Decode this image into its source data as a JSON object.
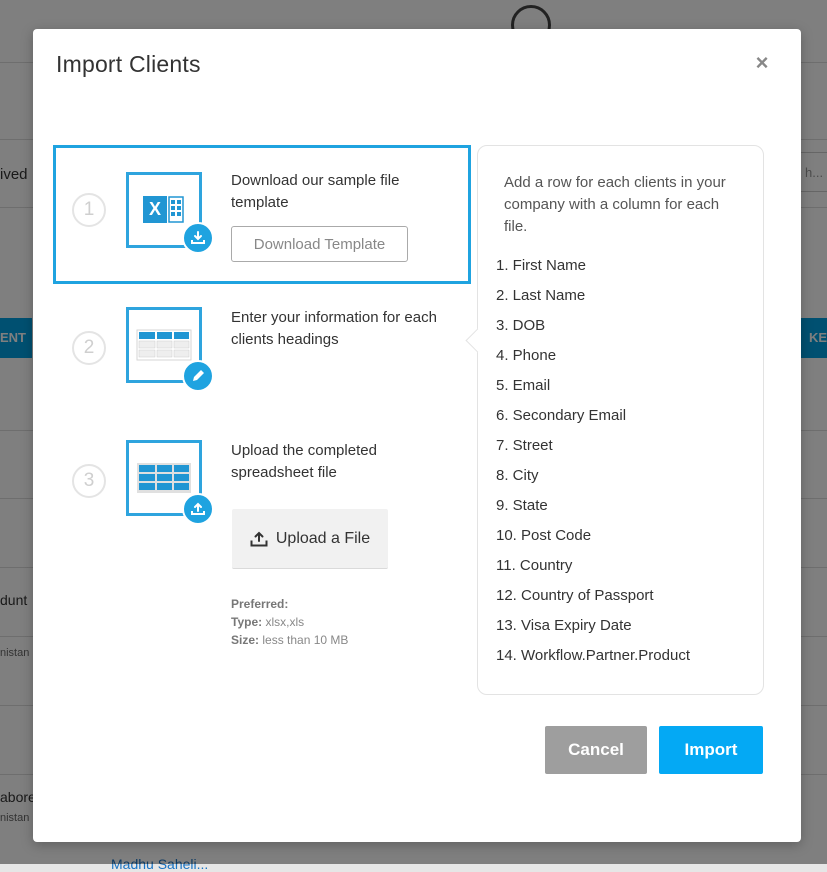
{
  "background": {
    "left_texts": [
      "ived",
      "dunt",
      "nistan",
      "abore",
      "nistan"
    ],
    "header_left": "ENT",
    "header_right": "KE",
    "search_placeholder": "h...",
    "bottom_link": "Madhu Saheli..."
  },
  "modal": {
    "title": "Import Clients",
    "close_symbol": "×",
    "steps": [
      {
        "number": "1",
        "text": "Download our sample file template",
        "button_label": "Download Template",
        "icon": "excel-file-icon",
        "badge_icon": "download-icon"
      },
      {
        "number": "2",
        "text": "Enter your information for each clients headings",
        "icon": "spreadsheet-icon",
        "badge_icon": "pencil-icon"
      },
      {
        "number": "3",
        "text": "Upload the completed spreadsheet file",
        "icon": "spreadsheet-icon",
        "badge_icon": "upload-icon",
        "button_label": "Upload a File",
        "preferred_label": "Preferred:",
        "type_label": "Type:",
        "type_value": "xlsx,xls",
        "size_label": "Size:",
        "size_value": "less than 10 MB"
      }
    ],
    "info": {
      "intro": "Add a row for each clients in your company with a column for each file.",
      "fields": [
        "1. First Name",
        "2. Last Name",
        "3. DOB",
        "4. Phone",
        "5. Email",
        "6. Secondary Email",
        "7. Street",
        "8. City",
        "9. State",
        "10. Post Code",
        "11. Country",
        "12. Country of Passport",
        "13. Visa Expiry Date",
        "14. Workflow.Partner.Product"
      ]
    },
    "cancel_label": "Cancel",
    "import_label": "Import"
  },
  "colors": {
    "accent": "#1fa3e0",
    "import_button": "#04a9f4",
    "cancel_button": "#9e9e9e",
    "overlay": "rgba(0,0,0,0.5)"
  }
}
